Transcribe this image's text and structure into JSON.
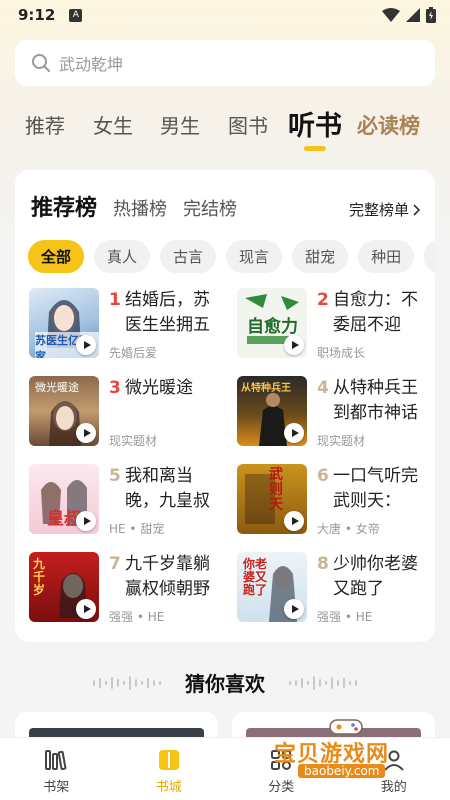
{
  "status_bar": {
    "time": "9:12",
    "app_letter": "A"
  },
  "search": {
    "placeholder": "武动乾坤"
  },
  "top_tabs": [
    "推荐",
    "女生",
    "男生",
    "图书",
    "听书",
    "必读榜"
  ],
  "ranking": {
    "tabs": [
      "推荐榜",
      "热播榜",
      "完结榜"
    ],
    "full_list": "完整榜单",
    "filters": [
      "全部",
      "真人",
      "古言",
      "现言",
      "甜宠",
      "种田"
    ],
    "items": [
      {
        "rank": "1",
        "title": "结婚后，苏医生坐拥五",
        "meta": "先婚后爱",
        "cover_text": "苏医生亿万家"
      },
      {
        "rank": "2",
        "title": "自愈力：不委屈不迎",
        "meta": "职场成长",
        "cover_text": "自愈力"
      },
      {
        "rank": "3",
        "title": "微光暖途",
        "meta": "现实题材",
        "cover_text": "微光暖途"
      },
      {
        "rank": "4",
        "title": "从特种兵王到都市神话",
        "meta": "现实题材",
        "cover_text": "从特种兵王"
      },
      {
        "rank": "5",
        "title": "我和离当晚，九皇叔",
        "meta": "HE • 甜宠",
        "cover_text": "皇叔"
      },
      {
        "rank": "6",
        "title": "一口气听完武则天：",
        "meta": "大唐 • 女帝",
        "cover_text": "武则天"
      },
      {
        "rank": "7",
        "title": "九千岁靠躺赢权倾朝野",
        "meta": "强强 • HE",
        "cover_text": "九千岁"
      },
      {
        "rank": "8",
        "title": "少帅你老婆又跑了",
        "meta": "强强 • HE",
        "cover_text": "你老婆又跑了"
      }
    ]
  },
  "guess_title": "猜你喜欢",
  "bottom_nav": [
    "书架",
    "书城",
    "分类",
    "我的"
  ],
  "watermark": {
    "text": "宝贝游戏网",
    "url": "baobeiy.com"
  },
  "colors": {
    "accent": "#f6c416",
    "rank_red": "#e8473b",
    "rank_gray": "#c9b49a"
  }
}
